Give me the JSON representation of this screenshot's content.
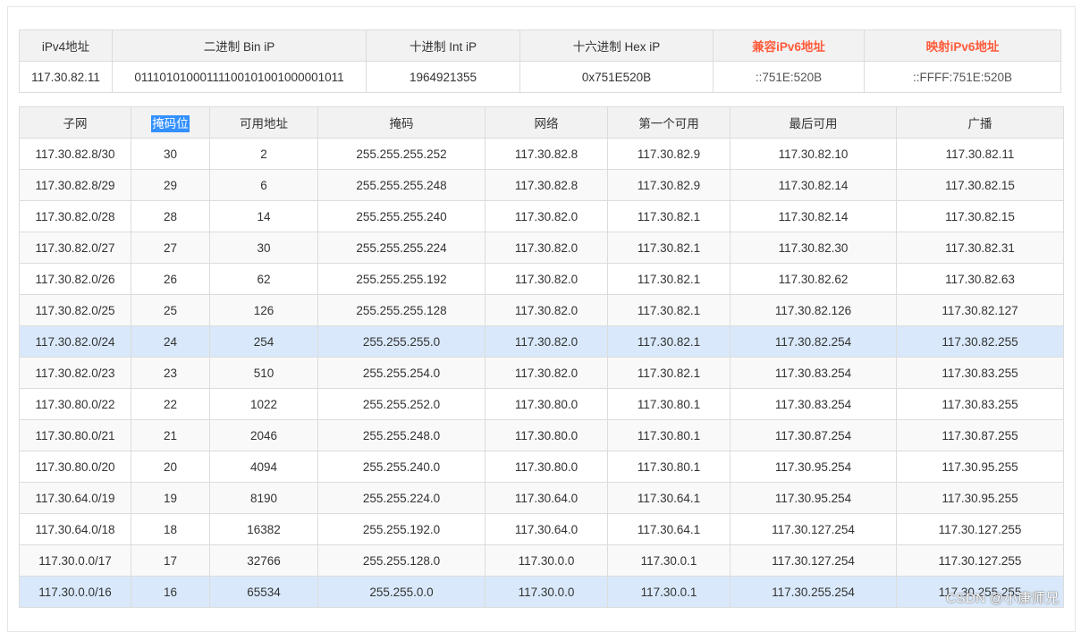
{
  "info_table": {
    "headers": [
      "iPv4地址",
      "二进制 Bin iP",
      "十进制 Int iP",
      "十六进制 Hex iP",
      "兼容iPv6地址",
      "映射iPv6地址"
    ],
    "values": [
      "117.30.82.11",
      "01110101000111100101001000001011",
      "1964921355",
      "0x751E520B",
      "::751E:520B",
      "::FFFF:751E:520B"
    ],
    "accent_color": "#ff5b3b"
  },
  "subnet_table": {
    "headers": [
      "子网",
      "掩码位",
      "可用地址",
      "掩码",
      "网络",
      "第一个可用",
      "最后可用",
      "广播"
    ],
    "selected_header_index": 1,
    "highlight_color": "#d9e9fb",
    "rows": [
      [
        "117.30.82.8/30",
        "30",
        "2",
        "255.255.255.252",
        "117.30.82.8",
        "117.30.82.9",
        "117.30.82.10",
        "117.30.82.11"
      ],
      [
        "117.30.82.8/29",
        "29",
        "6",
        "255.255.255.248",
        "117.30.82.8",
        "117.30.82.9",
        "117.30.82.14",
        "117.30.82.15"
      ],
      [
        "117.30.82.0/28",
        "28",
        "14",
        "255.255.255.240",
        "117.30.82.0",
        "117.30.82.1",
        "117.30.82.14",
        "117.30.82.15"
      ],
      [
        "117.30.82.0/27",
        "27",
        "30",
        "255.255.255.224",
        "117.30.82.0",
        "117.30.82.1",
        "117.30.82.30",
        "117.30.82.31"
      ],
      [
        "117.30.82.0/26",
        "26",
        "62",
        "255.255.255.192",
        "117.30.82.0",
        "117.30.82.1",
        "117.30.82.62",
        "117.30.82.63"
      ],
      [
        "117.30.82.0/25",
        "25",
        "126",
        "255.255.255.128",
        "117.30.82.0",
        "117.30.82.1",
        "117.30.82.126",
        "117.30.82.127"
      ],
      [
        "117.30.82.0/24",
        "24",
        "254",
        "255.255.255.0",
        "117.30.82.0",
        "117.30.82.1",
        "117.30.82.254",
        "117.30.82.255"
      ],
      [
        "117.30.82.0/23",
        "23",
        "510",
        "255.255.254.0",
        "117.30.82.0",
        "117.30.82.1",
        "117.30.83.254",
        "117.30.83.255"
      ],
      [
        "117.30.80.0/22",
        "22",
        "1022",
        "255.255.252.0",
        "117.30.80.0",
        "117.30.80.1",
        "117.30.83.254",
        "117.30.83.255"
      ],
      [
        "117.30.80.0/21",
        "21",
        "2046",
        "255.255.248.0",
        "117.30.80.0",
        "117.30.80.1",
        "117.30.87.254",
        "117.30.87.255"
      ],
      [
        "117.30.80.0/20",
        "20",
        "4094",
        "255.255.240.0",
        "117.30.80.0",
        "117.30.80.1",
        "117.30.95.254",
        "117.30.95.255"
      ],
      [
        "117.30.64.0/19",
        "19",
        "8190",
        "255.255.224.0",
        "117.30.64.0",
        "117.30.64.1",
        "117.30.95.254",
        "117.30.95.255"
      ],
      [
        "117.30.64.0/18",
        "18",
        "16382",
        "255.255.192.0",
        "117.30.64.0",
        "117.30.64.1",
        "117.30.127.254",
        "117.30.127.255"
      ],
      [
        "117.30.0.0/17",
        "17",
        "32766",
        "255.255.128.0",
        "117.30.0.0",
        "117.30.0.1",
        "117.30.127.254",
        "117.30.127.255"
      ],
      [
        "117.30.0.0/16",
        "16",
        "65534",
        "255.255.0.0",
        "117.30.0.0",
        "117.30.0.1",
        "117.30.255.254",
        "117.30.255.255"
      ]
    ],
    "highlighted_rows": [
      6,
      14
    ]
  },
  "watermark": "CSDN @小康师兄"
}
